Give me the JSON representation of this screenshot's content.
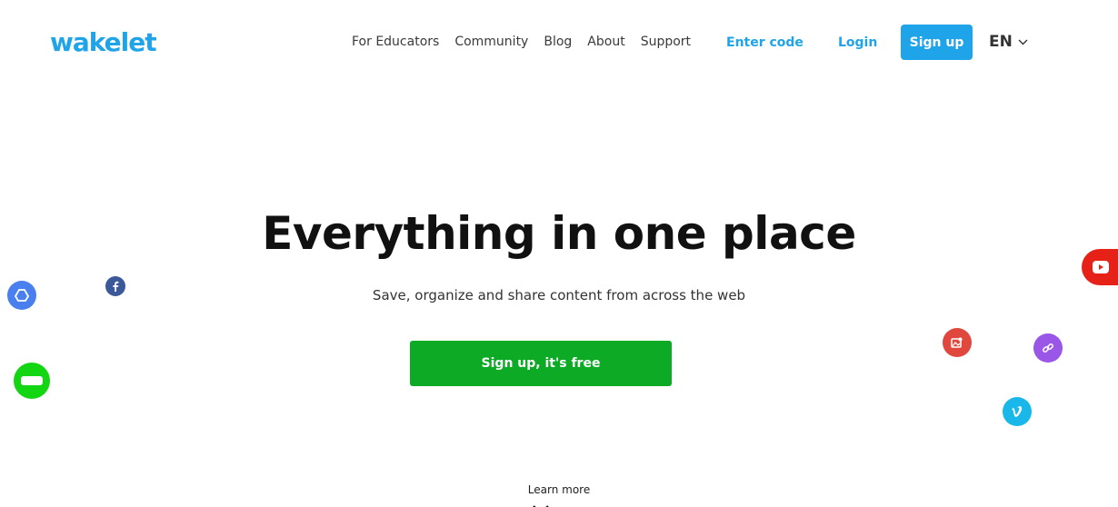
{
  "header": {
    "logo_text": "wakelet",
    "nav": [
      {
        "label": "For Educators"
      },
      {
        "label": "Community"
      },
      {
        "label": "Blog"
      },
      {
        "label": "About"
      },
      {
        "label": "Support"
      }
    ],
    "enter_code_label": "Enter code",
    "login_label": "Login",
    "signup_label": "Sign up",
    "language": "EN"
  },
  "hero": {
    "title": "Everything in one place",
    "subtitle": "Save, organize and share content from across the web",
    "cta_label": "Sign up, it's free",
    "learn_more_label": "Learn more"
  },
  "floating_icons": [
    {
      "name": "google-drive-icon",
      "color": "#4a7ff0"
    },
    {
      "name": "facebook-icon",
      "color": "#3b5998"
    },
    {
      "name": "flipgrid-icon",
      "color": "#13d613"
    },
    {
      "name": "youtube-icon",
      "color": "#e62117"
    },
    {
      "name": "image-icon",
      "color": "#e0483e"
    },
    {
      "name": "link-icon",
      "color": "#9a56e6"
    },
    {
      "name": "vimeo-icon",
      "color": "#1ab7ea"
    }
  ],
  "colors": {
    "brand_blue": "#1fa4e9",
    "cta_green": "#0daa25",
    "text_dark": "#111111"
  }
}
